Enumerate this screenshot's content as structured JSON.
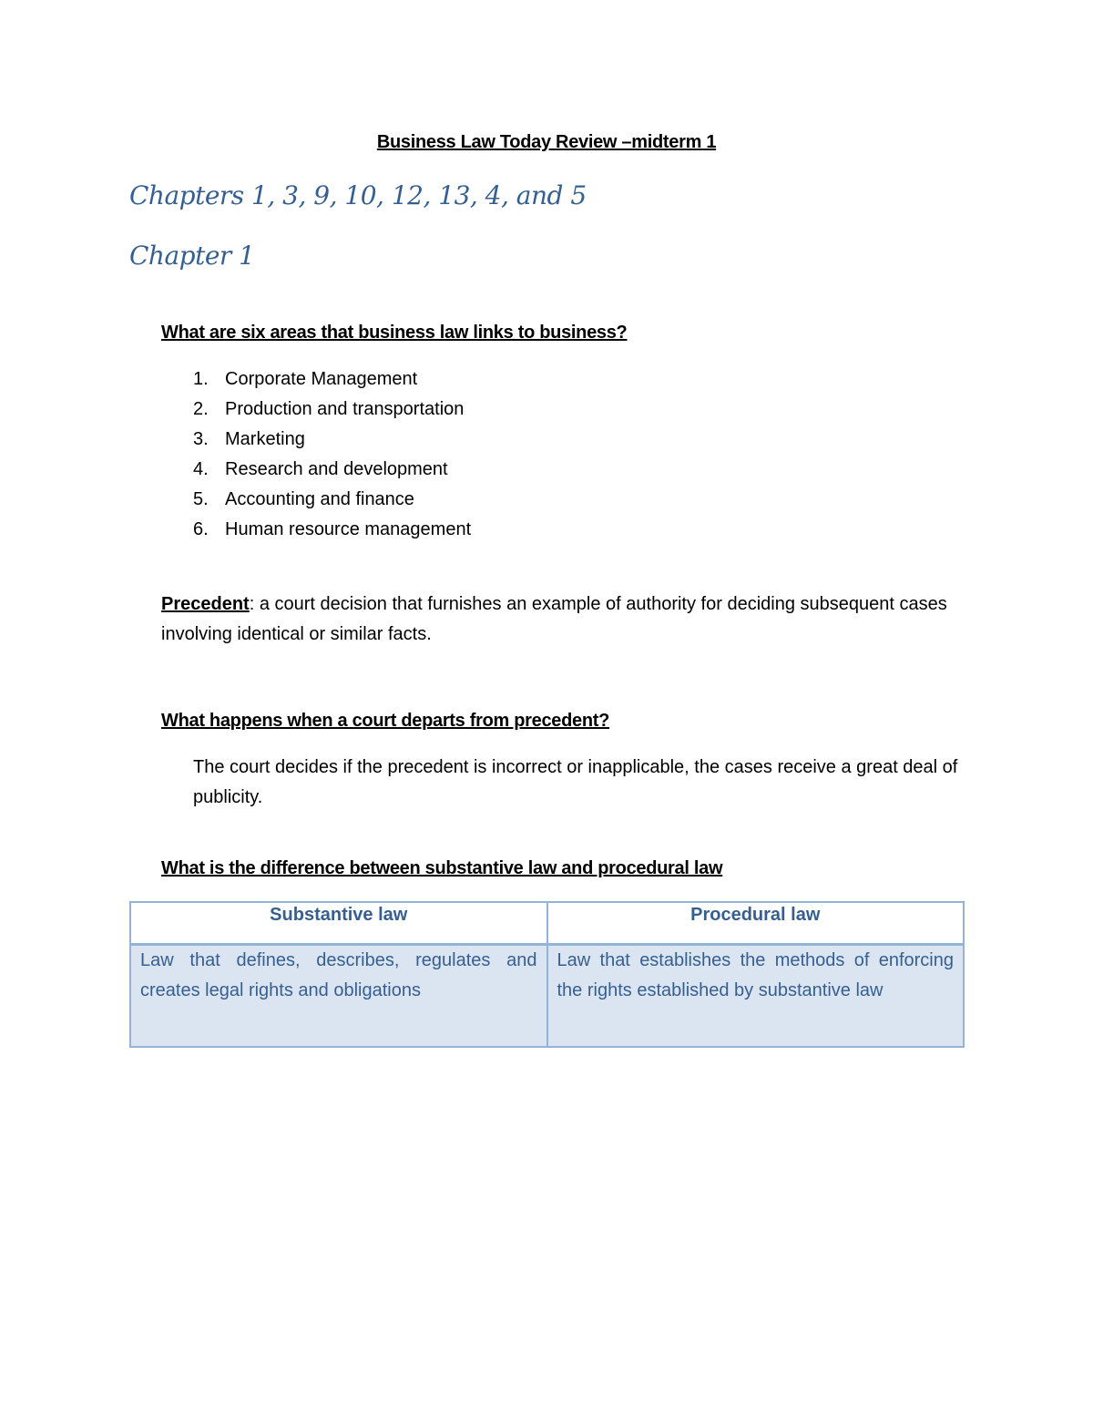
{
  "document": {
    "title": "Business Law Today Review –midterm 1",
    "chapters_heading": "Chapters 1, 3, 9, 10, 12, 13, 4, and 5",
    "chapter_heading": "Chapter 1"
  },
  "section_areas": {
    "question": "What are six areas that business law links to business?",
    "items": [
      {
        "number": "1.",
        "label": "Corporate Management"
      },
      {
        "number": "2.",
        "label": "Production and transportation"
      },
      {
        "number": "3.",
        "label": "Marketing"
      },
      {
        "number": "4.",
        "label": "Research and development"
      },
      {
        "number": "5.",
        "label": "Accounting and finance"
      },
      {
        "number": "6.",
        "label": "Human resource management"
      }
    ]
  },
  "precedent": {
    "term": "Precedent",
    "definition": ": a court decision that furnishes an example of authority for deciding subsequent cases involving identical or similar facts."
  },
  "section_departs": {
    "question": "What happens when a court departs from precedent?",
    "answer": "The court decides if the precedent is incorrect or inapplicable, the cases receive a great deal of publicity."
  },
  "section_difference": {
    "question": "What is the difference between substantive law and procedural law",
    "table": {
      "headers": [
        "Substantive law",
        "Procedural law"
      ],
      "rows": [
        [
          "Law that defines, describes, regulates and creates legal rights and obligations",
          "Law that establishes the methods of enforcing the rights established by substantive law"
        ]
      ]
    }
  },
  "colors": {
    "heading_blue": "#365f91",
    "table_border": "#95b3d7",
    "table_fill": "#dbe5f1"
  }
}
